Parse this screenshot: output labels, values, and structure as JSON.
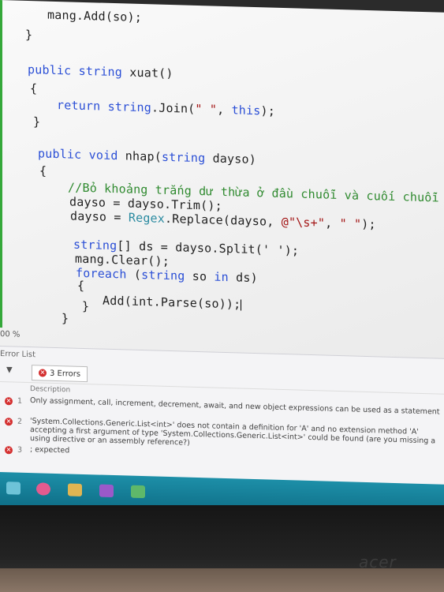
{
  "code": {
    "line1": "mang.Add(so);",
    "brace_close": "}",
    "xuat_public": "public",
    "xuat_string": "string",
    "xuat_name": " xuat()",
    "brace_open": "{",
    "ret_return": "return",
    "ret_string": "string",
    "ret_join": ".Join(",
    "ret_str": "\" \"",
    "ret_comma": ", ",
    "ret_this": "this",
    "ret_end": ");",
    "nhap_public": "public",
    "nhap_void": "void",
    "nhap_name": " nhap(",
    "nhap_string": "string",
    "nhap_param": " dayso)",
    "comment": "//Bỏ khoảng trắng dư thừa ở đầu chuỗi và cuối chuỗi",
    "trim": "dayso = dayso.Trim();",
    "regex_pre": "dayso = ",
    "regex_cls": "Regex",
    "regex_mid": ".Replace(dayso, ",
    "regex_str1": "@\"\\s+\"",
    "regex_comma": ", ",
    "regex_str2": "\" \"",
    "regex_end": ");",
    "split_string": "string",
    "split_rest": "[] ds = dayso.Split(' ');",
    "clear": "mang.Clear();",
    "foreach_kw": "foreach",
    "foreach_open": " (",
    "foreach_string": "string",
    "foreach_rest": " so ",
    "foreach_in": "in",
    "foreach_end": " ds)",
    "add": "Add(int.Parse(so));"
  },
  "zoom": "00 %",
  "error_panel": {
    "title": "Error List",
    "filter_icon": "filter-icon",
    "errors_button": "3 Errors",
    "description_header": "Description",
    "rows": [
      {
        "num": "1",
        "message": "Only assignment, call, increment, decrement, await, and new object expressions can be used as a statement"
      },
      {
        "num": "2",
        "message": "'System.Collections.Generic.List<int>' does not contain a definition for 'A' and no extension method 'A' accepting a first argument of type 'System.Collections.Generic.List<int>' could be found (are you missing a using directive or an assembly reference?)"
      },
      {
        "num": "3",
        "message": "; expected"
      }
    ]
  },
  "colors": {
    "keyword": "#2b4fd6",
    "type": "#2a8aa0",
    "string": "#a31515",
    "comment": "#2f8a2f",
    "error": "#d43030",
    "taskbar": "#1d8fa8"
  },
  "monitor_logo": "acer"
}
